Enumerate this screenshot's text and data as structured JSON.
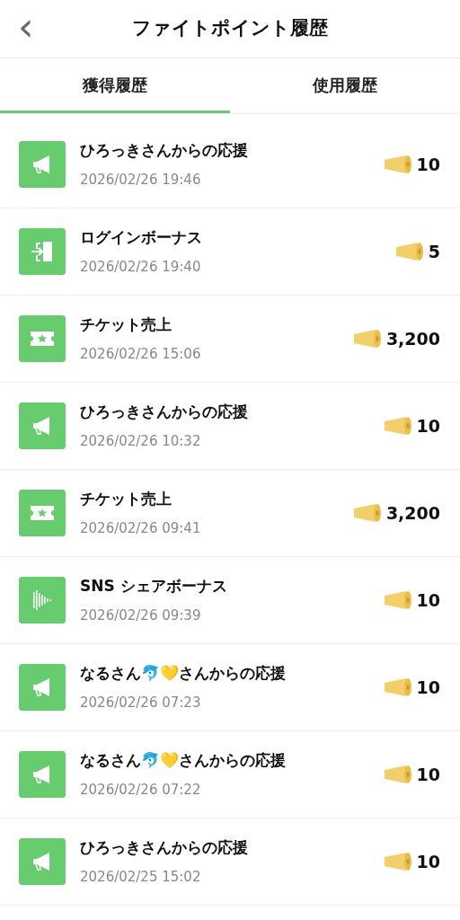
{
  "header": {
    "back": "‹",
    "title": "ファイトポイント履歴"
  },
  "tabs": [
    {
      "label": "獲得履歴",
      "selected": true
    },
    {
      "label": "使用履歴",
      "selected": false
    }
  ],
  "history": [
    {
      "kind": "cheer",
      "title": "ひろっきさんからの応援",
      "date": "2026/02/26 19:46",
      "points": "10"
    },
    {
      "kind": "login",
      "title": "ログインボーナス",
      "date": "2026/02/26 19:40",
      "points": "5"
    },
    {
      "kind": "ticket",
      "title": "チケット売上",
      "date": "2026/02/26 15:06",
      "points": "3,200"
    },
    {
      "kind": "cheer",
      "title": "ひろっきさんからの応援",
      "date": "2026/02/26 10:32",
      "points": "10"
    },
    {
      "kind": "ticket",
      "title": "チケット売上",
      "date": "2026/02/26 09:41",
      "points": "3,200"
    },
    {
      "kind": "share",
      "title": "SNS シェアボーナス",
      "date": "2026/02/26 09:39",
      "points": "10"
    },
    {
      "kind": "cheer",
      "title": "なるさん🐬💛さんからの応援",
      "date": "2026/02/26 07:23",
      "points": "10"
    },
    {
      "kind": "cheer",
      "title": "なるさん🐬💛さんからの応援",
      "date": "2026/02/26 07:22",
      "points": "10"
    },
    {
      "kind": "cheer",
      "title": "ひろっきさんからの応援",
      "date": "2026/02/25 15:02",
      "points": "10"
    }
  ]
}
